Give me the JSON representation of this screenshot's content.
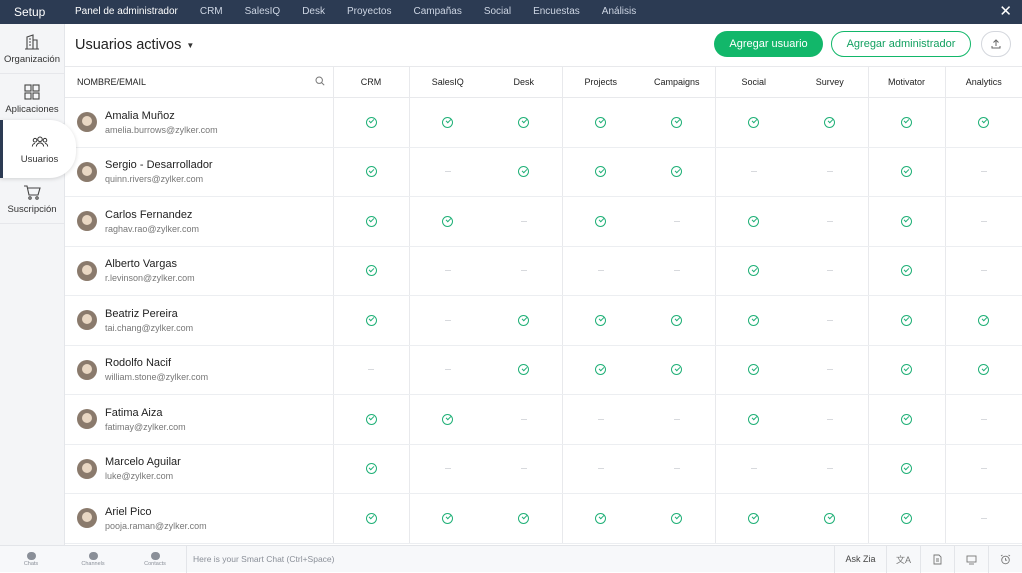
{
  "topbar": {
    "brand": "Setup",
    "nav": [
      "Panel de administrador",
      "CRM",
      "SalesIQ",
      "Desk",
      "Proyectos",
      "Campañas",
      "Social",
      "Encuestas",
      "Análisis"
    ],
    "active_index": 0
  },
  "sidebar": {
    "items": [
      {
        "label": "Organización",
        "icon": "building-icon"
      },
      {
        "label": "Aplicaciones",
        "icon": "apps-grid-icon"
      },
      {
        "label": "Usuarios",
        "icon": "users-icon"
      },
      {
        "label": "Suscripción",
        "icon": "cart-icon"
      }
    ],
    "active_index": 2
  },
  "header": {
    "title": "Usuarios activos",
    "add_user": "Agregar usuario",
    "add_admin": "Agregar administrador"
  },
  "table": {
    "name_header": "NOMBRE/EMAIL",
    "columns": [
      "CRM",
      "SalesIQ",
      "Desk",
      "Projects",
      "Campaigns",
      "Social",
      "Survey",
      "Motivator",
      "Analytics"
    ],
    "rows": [
      {
        "name": "Amalia Muñoz",
        "email": "amelia.burrows@zylker.com",
        "access": [
          1,
          1,
          1,
          1,
          1,
          1,
          1,
          1,
          1
        ]
      },
      {
        "name": "Sergio - Desarrollador",
        "email": "quinn.rivers@zylker.com",
        "access": [
          1,
          0,
          1,
          1,
          1,
          0,
          0,
          1,
          0
        ]
      },
      {
        "name": "Carlos Fernandez",
        "email": "raghav.rao@zylker.com",
        "access": [
          1,
          1,
          0,
          1,
          0,
          1,
          0,
          1,
          0
        ]
      },
      {
        "name": "Alberto Vargas",
        "email": "r.levinson@zylker.com",
        "access": [
          1,
          0,
          0,
          0,
          0,
          1,
          0,
          1,
          0
        ]
      },
      {
        "name": "Beatriz Pereira",
        "email": "tai.chang@zylker.com",
        "access": [
          1,
          0,
          1,
          1,
          1,
          1,
          0,
          1,
          1
        ]
      },
      {
        "name": "Rodolfo Nacif",
        "email": "william.stone@zylker.com",
        "access": [
          0,
          0,
          1,
          1,
          1,
          1,
          0,
          1,
          1
        ]
      },
      {
        "name": "Fatima Aiza",
        "email": "fatimay@zylker.com",
        "access": [
          1,
          1,
          0,
          0,
          0,
          1,
          0,
          1,
          0
        ]
      },
      {
        "name": "Marcelo Aguilar",
        "email": "luke@zylker.com",
        "access": [
          1,
          0,
          0,
          0,
          0,
          0,
          0,
          1,
          0
        ]
      },
      {
        "name": "Ariel Pico",
        "email": "pooja.raman@zylker.com",
        "access": [
          1,
          1,
          1,
          1,
          1,
          1,
          1,
          1,
          0
        ]
      }
    ]
  },
  "bottombar": {
    "items": [
      "Chats",
      "Channels",
      "Contacts"
    ],
    "smart_chat": "Here is your Smart Chat (Ctrl+Space)",
    "ask_zia": "Ask Zia"
  },
  "colors": {
    "topbar": "#2c3b53",
    "accent": "#12b76a",
    "check": "#20b077"
  }
}
